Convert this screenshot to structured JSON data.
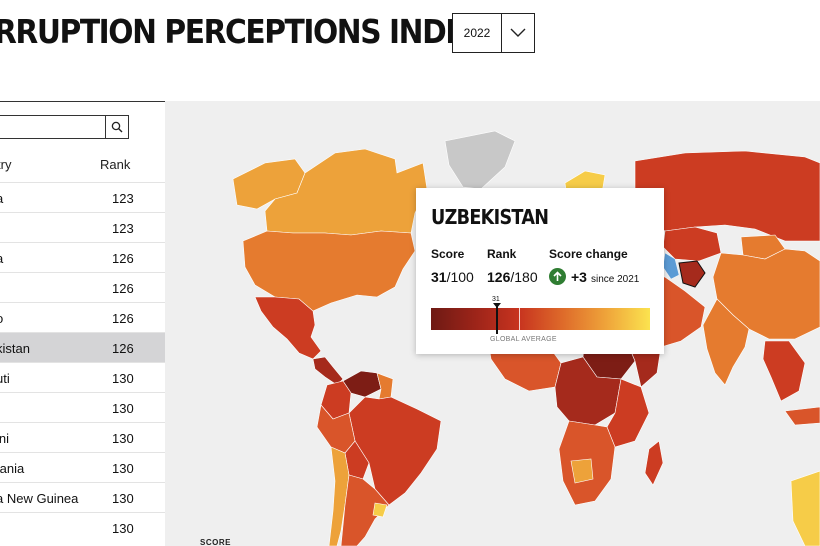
{
  "header": {
    "title": "RRUPTION PERCEPTIONS INDEX",
    "year_selected": "2022",
    "year_icon": "chevron-down-icon"
  },
  "table": {
    "search_value": "",
    "search_icon": "search-icon",
    "column_country": "try",
    "column_rank": "Rank",
    "rows": [
      {
        "country": "a",
        "rank": "123"
      },
      {
        "country": "",
        "rank": "123"
      },
      {
        "country": "a",
        "rank": "126"
      },
      {
        "country": "",
        "rank": "126"
      },
      {
        "country": "o",
        "rank": "126"
      },
      {
        "country": "kistan",
        "rank": "126"
      },
      {
        "country": "uti",
        "rank": "130"
      },
      {
        "country": "",
        "rank": "130"
      },
      {
        "country": "ini",
        "rank": "130"
      },
      {
        "country": "tania",
        "rank": "130"
      },
      {
        "country": "a New Guinea",
        "rank": "130"
      },
      {
        "country": "",
        "rank": "130"
      }
    ],
    "selected_index": 5
  },
  "map": {
    "legend_label": "SCORE",
    "colors": {
      "ocean": "#efefef",
      "no_data": "#c8c8c8",
      "water": "#5b9bd5",
      "very_low": "#7d1d15",
      "low": "#a52a1c",
      "mid_low": "#cc3c22",
      "mid": "#d9552a",
      "mid_high": "#e57b2f",
      "high": "#eda23a",
      "very_high": "#f6cc48"
    }
  },
  "tooltip": {
    "country": "UZBEKISTAN",
    "score_label": "Score",
    "score_value": "31",
    "score_max": "/100",
    "rank_label": "Rank",
    "rank_value": "126",
    "rank_max": "/180",
    "change_label": "Score change",
    "change_icon": "arrow-up-icon",
    "change_value": "+3",
    "change_since": "since 2021",
    "scale_marker_label": "31",
    "scale_marker_value": 31,
    "global_average_label": "GLOBAL AVERAGE",
    "global_average_value": 43
  }
}
